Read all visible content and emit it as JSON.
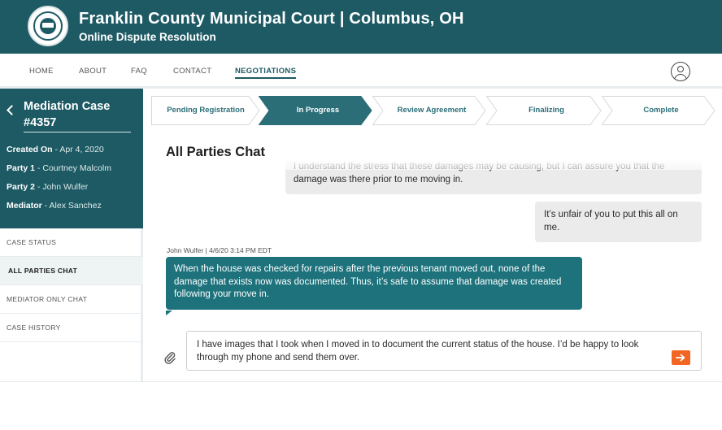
{
  "header": {
    "title": "Franklin County Municipal Court | Columbus, OH",
    "subtitle": "Online Dispute Resolution",
    "seal_icon": "county-seal-logo",
    "color": "#1d5a64"
  },
  "nav": {
    "items": [
      {
        "label": "HOME"
      },
      {
        "label": "ABOUT"
      },
      {
        "label": "FAQ"
      },
      {
        "label": "CONTACT"
      },
      {
        "label": "NEGOTIATIONS",
        "active": true
      }
    ],
    "user_icon": "user-avatar-icon"
  },
  "case": {
    "title": "Mediation Case #4357",
    "fields": [
      {
        "label": "Created On",
        "value": "Apr 4, 2020"
      },
      {
        "label": "Party 1",
        "value": "Courtney Malcolm"
      },
      {
        "label": "Party 2",
        "value": "John Wulfer"
      },
      {
        "label": "Mediator",
        "value": "Alex Sanchez"
      }
    ]
  },
  "sidebar": {
    "menu": [
      {
        "label": "CASE STATUS"
      },
      {
        "label": "ALL PARTIES CHAT",
        "active": true
      },
      {
        "label": "MEDIATOR ONLY CHAT"
      },
      {
        "label": "CASE HISTORY"
      }
    ]
  },
  "steps": {
    "items": [
      {
        "label": "Pending Registration"
      },
      {
        "label": "In Progress",
        "current": true
      },
      {
        "label": "Review Agreement"
      },
      {
        "label": "Finalizing"
      },
      {
        "label": "Complete"
      }
    ],
    "current_color": "#2b6e78"
  },
  "chat": {
    "title": "All Parties Chat",
    "messages": [
      {
        "side": "mine",
        "text": "I understand the stress that these damages may be causing, but I can assure you that the damage was there prior to me moving in."
      },
      {
        "side": "mine",
        "text": "It’s unfair of you to put this all on me."
      },
      {
        "side": "theirs",
        "meta": "John Wulfer | 4/6/20 3:14 PM EDT",
        "text": "When the house was checked for repairs after the previous tenant moved out, none of the damage that exists now was documented. Thus, it’s safe to assume that damage was created following your move in."
      }
    ],
    "composer_text": "I have images that I took when I moved in to document the current status of the house. I’d be happy to look through my phone and send them over.",
    "attach_icon": "paperclip-icon",
    "send_icon": "send-arrow-icon",
    "send_color": "#f26522"
  }
}
